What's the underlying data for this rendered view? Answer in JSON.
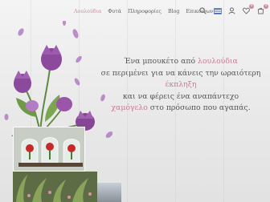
{
  "nav": {
    "items": [
      {
        "label": "Λουλούδια",
        "accent": true
      },
      {
        "label": "Φυτά",
        "accent": false
      },
      {
        "label": "Πληροφορίες",
        "accent": false
      },
      {
        "label": "Blog",
        "accent": false
      },
      {
        "label": "Επικοινωνία",
        "accent": false
      }
    ]
  },
  "header_icons": [
    "search-icon",
    "language-flag-icon",
    "user-icon",
    "heart-icon",
    "cart-icon"
  ],
  "counts": {
    "wishlist": "0",
    "cart": "0"
  },
  "tagline": {
    "line1_pre": "Ένα μπουκέτο από ",
    "line1_accent": "λουλούδια",
    "line2": "σε περιμένει για να κάνεις την ωραιότερη",
    "line3_accent": "έκπληξη",
    "line4": "και να φέρεις ένα αναπάντεχο",
    "line5_accent": "χαμόγελο",
    "line5_post": " στο πρόσωπο που αγαπάς."
  },
  "colors": {
    "accent": "#c97b92",
    "text": "#555555",
    "flower": "#8b4a9c"
  }
}
